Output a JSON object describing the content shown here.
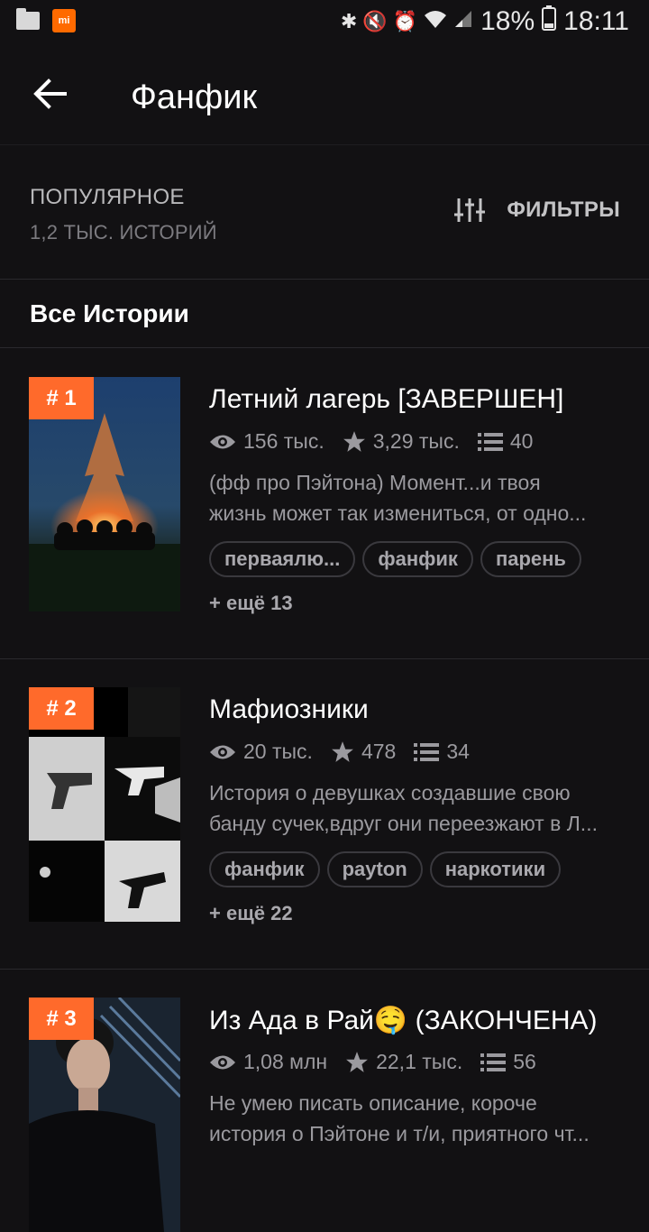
{
  "status_bar": {
    "battery": "18%",
    "time": "18:11"
  },
  "appbar": {
    "title": "Фанфик"
  },
  "sort": {
    "label": "ПОПУЛЯРНОЕ",
    "count": "1,2 ТЫС. ИСТОРИЙ"
  },
  "filters": {
    "label": "ФИЛЬТРЫ"
  },
  "section_title": "Все Истории",
  "stories": [
    {
      "rank": "# 1",
      "title": "Летний лагерь [ЗАВЕРШЕН]",
      "views": "156 тыс.",
      "votes": "3,29 тыс.",
      "parts": "40",
      "desc1": "(фф про Пэйтона) Момент...и твоя",
      "desc2": "жизнь может так измениться, от одно...",
      "tags": [
        "перваялю...",
        "фанфик",
        "парень"
      ],
      "more": "+ ещё 13"
    },
    {
      "rank": "# 2",
      "title": "Мафиозники",
      "views": "20 тыс.",
      "votes": "478",
      "parts": "34",
      "desc1": "История о девушках создавшие свою",
      "desc2": "банду сучек,вдруг они переезжают в Л...",
      "tags": [
        "фанфик",
        "payton",
        "наркотики"
      ],
      "more": "+ ещё 22"
    },
    {
      "rank": "# 3",
      "title": "Из Ада в Рай🤤 (ЗАКОНЧЕНА)",
      "views": "1,08 млн",
      "votes": "22,1 тыс.",
      "parts": "56",
      "desc1": "Не умею писать описание, короче",
      "desc2": "история о Пэйтоне и т/и, приятного чт..."
    }
  ]
}
